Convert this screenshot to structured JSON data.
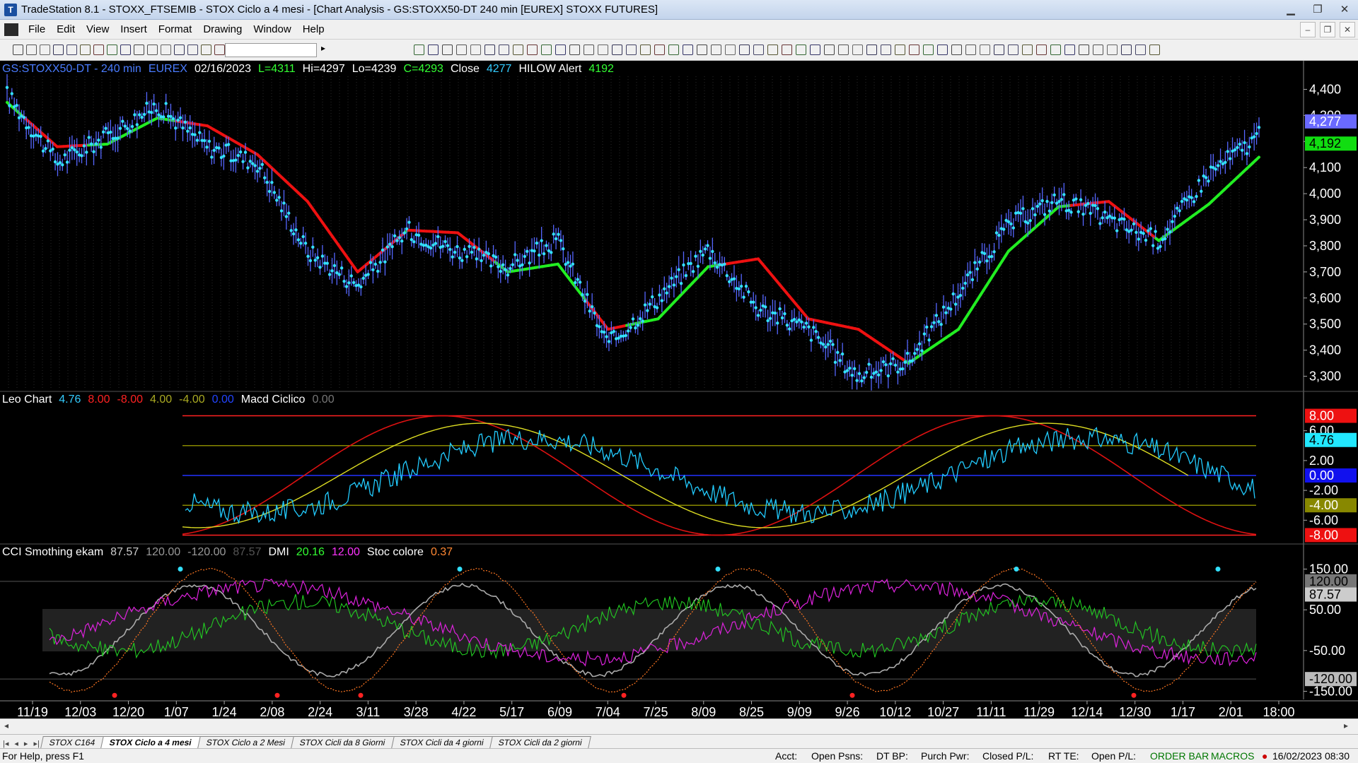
{
  "window": {
    "title": "TradeStation 8.1 - STOXX_FTSEMIB - STOX Ciclo a 4 mesi - [Chart Analysis - GS:STOXX50-DT  240 min  [EUREX] STOXX FUTURES]"
  },
  "menu": [
    "File",
    "Edit",
    "View",
    "Insert",
    "Format",
    "Drawing",
    "Window",
    "Help"
  ],
  "price_pane": {
    "header": [
      {
        "text": "GS:STOXX50-DT - 240 min",
        "color": "#4a7cff"
      },
      {
        "text": "EUREX",
        "color": "#4a7cff"
      },
      {
        "text": "02/16/2023",
        "color": "#ffffff"
      },
      {
        "text": "L=4311",
        "color": "#33ff33"
      },
      {
        "text": "Hi=4297",
        "color": "#ffffff"
      },
      {
        "text": "Lo=4239",
        "color": "#ffffff"
      },
      {
        "text": "C=4293",
        "color": "#33ff33"
      },
      {
        "text": "Close",
        "color": "#ffffff"
      },
      {
        "text": "4277",
        "color": "#33ccff"
      },
      {
        "text": "HILOW Alert",
        "color": "#ffffff"
      },
      {
        "text": "4192",
        "color": "#33ff33"
      }
    ],
    "y_ticks": [
      "4,400",
      "4,300",
      "4,200",
      "4,100",
      "4,000",
      "3,900",
      "3,800",
      "3,700",
      "3,600",
      "3,500",
      "3,400",
      "3,300"
    ],
    "y_tick_values": [
      4400,
      4300,
      4200,
      4100,
      4000,
      3900,
      3800,
      3700,
      3600,
      3500,
      3400,
      3300
    ],
    "ylim": [
      3250,
      4450
    ],
    "badges": [
      {
        "text": "4,277",
        "value": 4277,
        "bg": "#6a6aff",
        "fg": "#ffffff"
      },
      {
        "text": "4,192",
        "value": 4192,
        "bg": "#11dd11",
        "fg": "#000000"
      }
    ]
  },
  "leo_pane": {
    "header": [
      {
        "text": "Leo Chart",
        "color": "#ffffff"
      },
      {
        "text": "4.76",
        "color": "#33ccff"
      },
      {
        "text": "8.00",
        "color": "#ff2222"
      },
      {
        "text": "-8.00",
        "color": "#ff2222"
      },
      {
        "text": "4.00",
        "color": "#aaaa22"
      },
      {
        "text": "-4.00",
        "color": "#aaaa22"
      },
      {
        "text": "0.00",
        "color": "#2244ff"
      },
      {
        "text": "Macd Ciclico",
        "color": "#ffffff"
      },
      {
        "text": "0.00",
        "color": "#777777"
      }
    ],
    "y_ticks": [
      "6.00",
      "2.00",
      "-2.00",
      "-6.00"
    ],
    "y_tick_values": [
      6,
      2,
      -2,
      -6
    ],
    "ylim": [
      -9,
      9
    ],
    "badges": [
      {
        "text": "8.00",
        "value": 8,
        "bg": "#ee1111",
        "fg": "#ffffff"
      },
      {
        "text": "4.76",
        "value": 4.76,
        "bg": "#22e8ff",
        "fg": "#000000"
      },
      {
        "text": "0.00",
        "value": 0,
        "bg": "#1111ee",
        "fg": "#ffffff"
      },
      {
        "text": "-4.00",
        "value": -4,
        "bg": "#888800",
        "fg": "#ffffff"
      },
      {
        "text": "-8.00",
        "value": -8,
        "bg": "#ee1111",
        "fg": "#ffffff"
      }
    ],
    "levels": [
      {
        "value": 8,
        "color": "#ff2222"
      },
      {
        "value": 4,
        "color": "#888800"
      },
      {
        "value": 0,
        "color": "#2233ff"
      },
      {
        "value": -4,
        "color": "#888800"
      },
      {
        "value": -8,
        "color": "#ff2222"
      }
    ]
  },
  "cci_pane": {
    "header": [
      {
        "text": "CCI Smothing ekam",
        "color": "#ffffff"
      },
      {
        "text": "87.57",
        "color": "#cccccc"
      },
      {
        "text": "120.00",
        "color": "#999999"
      },
      {
        "text": "-120.00",
        "color": "#999999"
      },
      {
        "text": "87.57",
        "color": "#555555"
      },
      {
        "text": "DMI",
        "color": "#ffffff"
      },
      {
        "text": "20.16",
        "color": "#33ff33"
      },
      {
        "text": "12.00",
        "color": "#ff33ff"
      },
      {
        "text": "Stoc colore",
        "color": "#ffffff"
      },
      {
        "text": "0.37",
        "color": "#ff8833"
      }
    ],
    "y_ticks": [
      "150.00",
      "50.00",
      "-50.00",
      "-150.00"
    ],
    "y_tick_values": [
      150,
      50,
      -50,
      -150
    ],
    "ylim": [
      -170,
      170
    ],
    "badges": [
      {
        "text": "120.00",
        "value": 120,
        "bg": "#777777",
        "fg": "#000000"
      },
      {
        "text": "87.57",
        "value": 87.57,
        "bg": "#cccccc",
        "fg": "#000000"
      },
      {
        "text": "-120.00",
        "value": -120,
        "bg": "#bbbbbb",
        "fg": "#000000"
      }
    ]
  },
  "x_axis": {
    "labels": [
      "11/19",
      "12/03",
      "12/20",
      "1/07",
      "1/24",
      "2/08",
      "2/24",
      "3/11",
      "3/28",
      "4/22",
      "5/17",
      "6/09",
      "7/04",
      "7/25",
      "8/09",
      "8/25",
      "9/09",
      "9/26",
      "10/12",
      "10/27",
      "11/11",
      "11/29",
      "12/14",
      "12/30",
      "1/17",
      "2/01",
      "18:00"
    ]
  },
  "chart_data": {
    "type": "line",
    "title": "",
    "xlabel": "",
    "ylabel": "",
    "x": [
      "11/19",
      "12/03",
      "12/20",
      "1/07",
      "1/24",
      "2/08",
      "2/24",
      "3/11",
      "3/28",
      "4/22",
      "5/17",
      "6/09",
      "7/04",
      "7/25",
      "8/09",
      "8/25",
      "9/09",
      "9/26",
      "10/12",
      "10/27",
      "11/11",
      "11/29",
      "12/14",
      "12/30",
      "1/17",
      "2/01"
    ],
    "series": [
      {
        "name": "Close",
        "values": [
          4380,
          4120,
          4220,
          4340,
          4180,
          4120,
          3780,
          3650,
          3860,
          3780,
          3720,
          3820,
          3420,
          3600,
          3790,
          3560,
          3480,
          3300,
          3360,
          3620,
          3880,
          3980,
          3900,
          3820,
          4080,
          4220
        ]
      },
      {
        "name": "HILOW Alert",
        "values": [
          4350,
          4180,
          4190,
          4290,
          4260,
          4150,
          3970,
          3700,
          3860,
          3850,
          3700,
          3730,
          3480,
          3520,
          3720,
          3750,
          3520,
          3480,
          3350,
          3480,
          3780,
          3950,
          3970,
          3820,
          3960,
          4140
        ]
      }
    ],
    "ylim": [
      3250,
      4450
    ]
  },
  "bottom_tabs": [
    "STOX C164",
    "STOX Ciclo a 4 mesi",
    "STOX Ciclo a 2 Mesi",
    "STOX Cicli da 8 Giorni",
    "STOX Cicli da 4 giorni",
    "STOX Cicli da 2 giorni"
  ],
  "status": {
    "help": "For Help, press F1",
    "acct": "Acct:",
    "open_psns": "Open Psns:",
    "dt_bp": "DT BP:",
    "purch_pwr": "Purch Pwr:",
    "closed_pl": "Closed P/L:",
    "rt_te": "RT TE:",
    "open_pl": "Open P/L:",
    "order_bar": "ORDER BAR",
    "macros": "MACROS",
    "datetime": "16/02/2023 08:30"
  }
}
